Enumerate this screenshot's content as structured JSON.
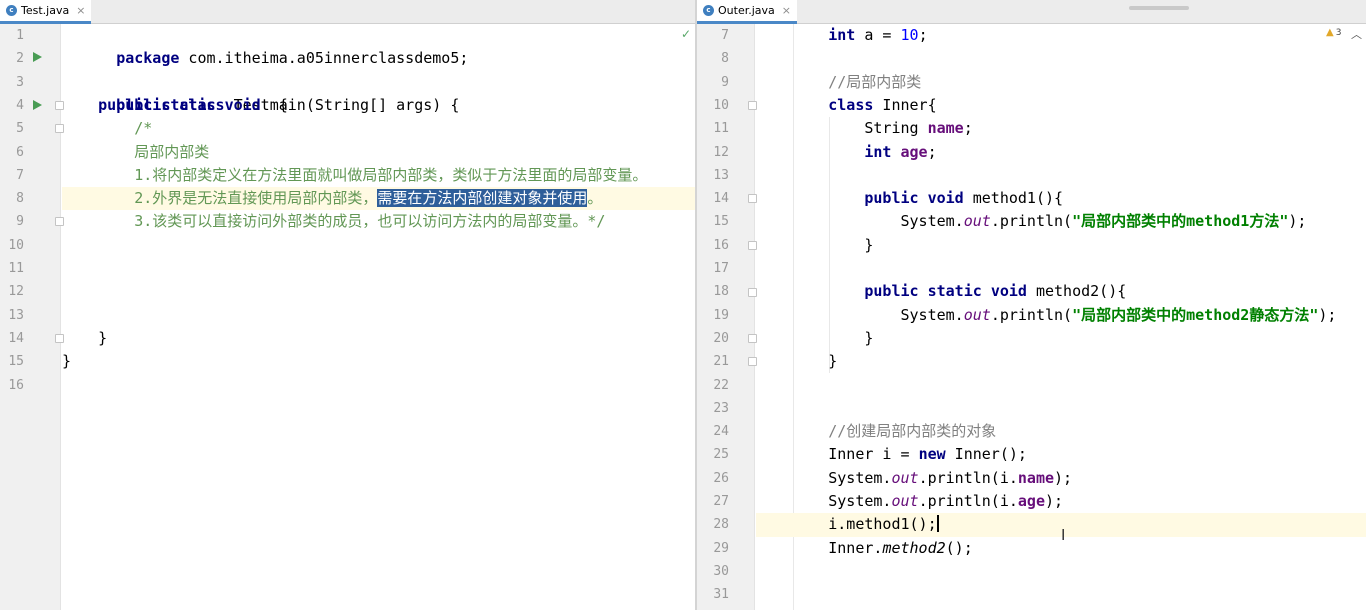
{
  "left": {
    "tab": {
      "icon": "c",
      "label": "Test.java",
      "close": "×"
    },
    "status_icon": "✓",
    "line_numbers": [
      "1",
      "2",
      "3",
      "4",
      "5",
      "6",
      "7",
      "8",
      "9",
      "10",
      "11",
      "12",
      "13",
      "14",
      "15",
      "16"
    ],
    "code": {
      "l1": {
        "kw": "package",
        "rest": " com.itheima.a05innerclassdemo5;"
      },
      "l3": {
        "kw1": "public",
        "kw2": "class",
        "rest": " Test {"
      },
      "l4": {
        "kw1": "public",
        "kw2": "static",
        "kw3": "void",
        "rest": " main(String[] args) {"
      },
      "l5": "/*",
      "l6": "局部内部类",
      "l7": "1.将内部类定义在方法里面就叫做局部内部类，类似于方法里面的局部变量。",
      "l8_pre": "2.外界是无法直接使用局部内部类，",
      "l8_sel": "需要在方法内部创建对象并使用",
      "l8_post": "。",
      "l9": "3.该类可以直接访问外部类的成员，也可以访问方法内的局部变量。*/",
      "l14": "}",
      "l15": "}"
    }
  },
  "right": {
    "tab": {
      "icon": "c",
      "label": "Outer.java",
      "close": "×"
    },
    "warning_count": "3",
    "line_numbers": [
      "7",
      "8",
      "9",
      "10",
      "11",
      "12",
      "13",
      "14",
      "15",
      "16",
      "17",
      "18",
      "19",
      "20",
      "21",
      "22",
      "23",
      "24",
      "25",
      "26",
      "27",
      "28",
      "29",
      "30",
      "31"
    ],
    "code": {
      "l7": {
        "kw": "int",
        "var": " a = ",
        "num": "10",
        "end": ";"
      },
      "l9": "//局部内部类",
      "l10": {
        "kw": "class",
        "rest": " Inner{"
      },
      "l11": {
        "type": "String ",
        "fld": "name",
        "end": ";"
      },
      "l12": {
        "kw": "int",
        "sp": " ",
        "fld": "age",
        "end": ";"
      },
      "l14": {
        "kw1": "public",
        "kw2": "void",
        "rest": " method1(){"
      },
      "l15": {
        "a": "System.",
        "out": "out",
        "b": ".println(",
        "str": "\"局部内部类中的method1方法\"",
        "c": ");"
      },
      "l16": "}",
      "l18": {
        "kw1": "public",
        "kw2": "static",
        "kw3": "void",
        "rest": " method2(){"
      },
      "l19": {
        "a": "System.",
        "out": "out",
        "b": ".println(",
        "str": "\"局部内部类中的method2静态方法\"",
        "c": ");"
      },
      "l20": "}",
      "l21": "}",
      "l24": "//创建局部内部类的对象",
      "l25": {
        "a": "Inner i = ",
        "kw": "new",
        "b": " Inner();"
      },
      "l26": {
        "a": "System.",
        "out": "out",
        "b": ".println(i.",
        "fld": "name",
        "c": ");"
      },
      "l27": {
        "a": "System.",
        "out": "out",
        "b": ".println(i.",
        "fld": "age",
        "c": ");"
      },
      "l28": "i.method1();",
      "l29": {
        "a": "Inner.",
        "m": "method2",
        "b": "();"
      }
    }
  },
  "colors": {
    "keyword": "#000080",
    "field": "#660e7a",
    "number": "#0000ff",
    "string": "#008000",
    "comment": "#808080",
    "doc_comment": "#629755",
    "selection": "#2e5e9a",
    "current_line": "#fffae3",
    "run_icon": "#499c54"
  },
  "icons": {
    "run": "run-gutter-icon",
    "fold": "fold-marker-icon",
    "check": "check-icon",
    "warning": "warning-icon",
    "text_cursor": "text-cursor-icon"
  }
}
